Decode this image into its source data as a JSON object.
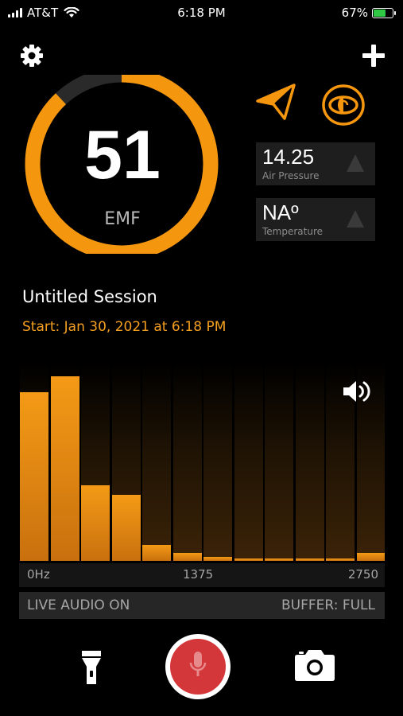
{
  "status_bar": {
    "carrier": "AT&T",
    "time": "6:18 PM",
    "battery": "67%",
    "battery_level": 0.67
  },
  "gauge": {
    "value": "51",
    "unit": "EMF",
    "fraction": 0.88,
    "accent_color": "#f5960f",
    "track_color": "#2a2a2a"
  },
  "sensors": {
    "air_pressure": {
      "value": "14.25",
      "label": "Air Pressure"
    },
    "temperature": {
      "value": "NAº",
      "label": "Temperature"
    }
  },
  "session": {
    "title": "Untitled Session",
    "start": "Start: Jan 30, 2021 at 6:18 PM"
  },
  "spectrum": {
    "levels": [
      0.87,
      0.95,
      0.39,
      0.34,
      0.08,
      0.04,
      0.02,
      0.01,
      0.01,
      0.01,
      0.01,
      0.04
    ],
    "axis": {
      "start": "0Hz",
      "mid": "1375",
      "end": "2750"
    }
  },
  "footer": {
    "live_audio": "LIVE AUDIO ON",
    "buffer": "BUFFER: FULL"
  },
  "icons": [
    "gear-icon",
    "plus-icon",
    "navigation-arrow-icon",
    "eye-icon",
    "speaker-icon",
    "flashlight-icon",
    "microphone-icon",
    "camera-icon"
  ]
}
